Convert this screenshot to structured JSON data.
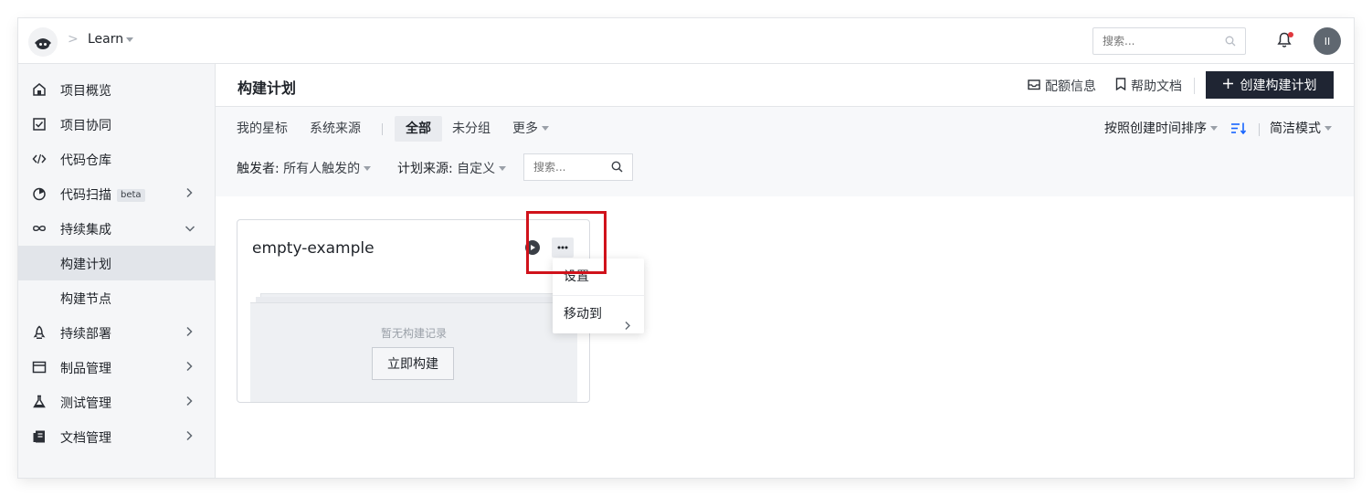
{
  "topbar": {
    "breadcrumb_sep": ">",
    "project_name": "Learn",
    "search_placeholder": "搜索...",
    "avatar_initials": "II"
  },
  "sidebar": {
    "items": [
      {
        "label": "项目概览",
        "icon": "home-icon"
      },
      {
        "label": "项目协同",
        "icon": "checklist-icon"
      },
      {
        "label": "代码仓库",
        "icon": "code-icon"
      },
      {
        "label": "代码扫描",
        "icon": "scan-icon",
        "badge": "beta"
      },
      {
        "label": "持续集成",
        "icon": "infinity-icon"
      },
      {
        "label": "构建计划"
      },
      {
        "label": "构建节点"
      },
      {
        "label": "持续部署",
        "icon": "rocket-icon"
      },
      {
        "label": "制品管理",
        "icon": "package-icon"
      },
      {
        "label": "测试管理",
        "icon": "flask-icon"
      },
      {
        "label": "文档管理",
        "icon": "book-icon"
      }
    ]
  },
  "header": {
    "title": "构建计划",
    "quota_info": "配额信息",
    "help_docs": "帮助文档",
    "create_button": "创建构建计划"
  },
  "tabs": {
    "starred": "我的星标",
    "system_source": "系统来源",
    "all": "全部",
    "ungrouped": "未分组",
    "more": "更多"
  },
  "sort": {
    "label": "按照创建时间排序",
    "mode": "简洁模式"
  },
  "filters": {
    "trigger_label": "触发者:",
    "trigger_value": "所有人触发的",
    "source_label": "计划来源:",
    "source_value": "自定义",
    "search_placeholder": "搜索..."
  },
  "card": {
    "title": "empty-example",
    "empty_text": "暂无构建记录",
    "build_now": "立即构建"
  },
  "dropdown": {
    "settings": "设置",
    "move_to": "移动到"
  },
  "colors": {
    "accent_dark": "#1f2533",
    "notification_dot": "#e0383e",
    "highlight": "#d0121b",
    "sort_icon": "#1664ff"
  }
}
